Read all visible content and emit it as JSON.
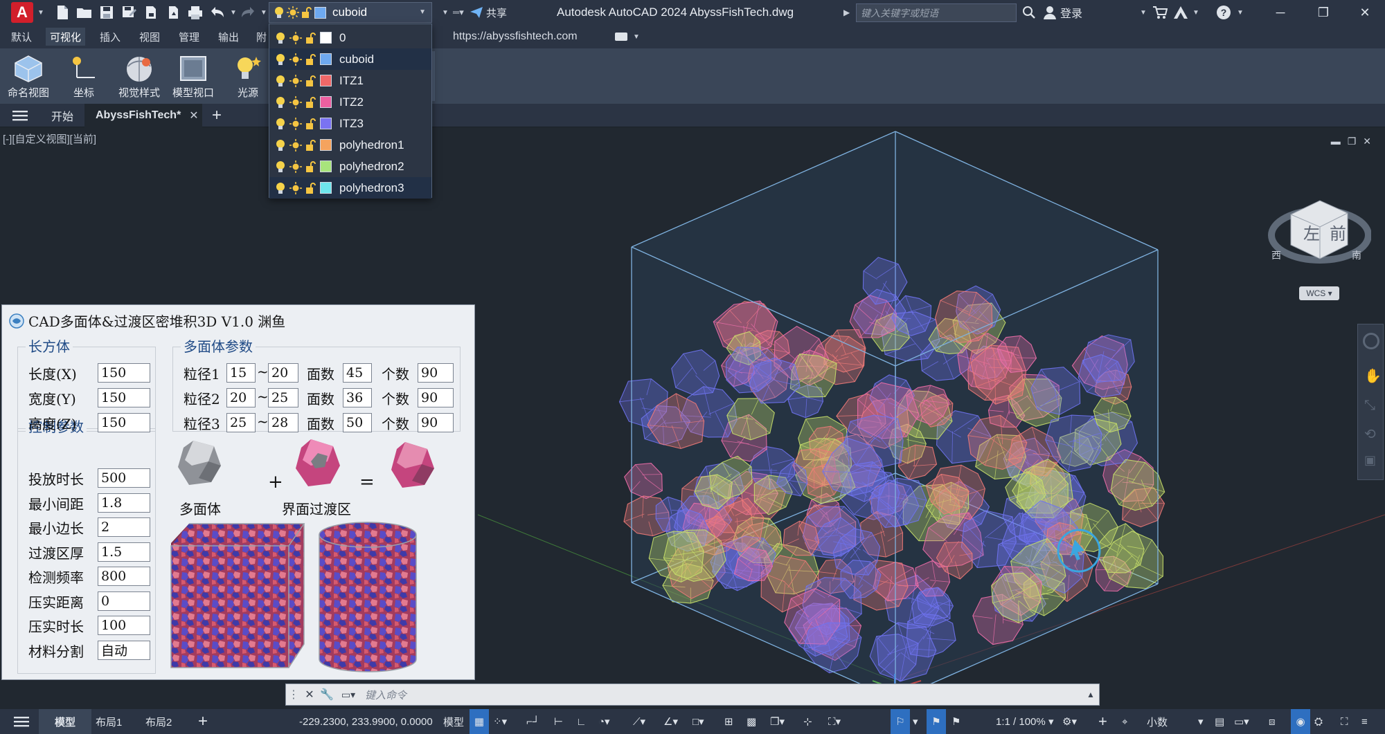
{
  "titlebar": {
    "logo": "A",
    "layer_current": "cuboid",
    "share": "共享",
    "app_title": "Autodesk AutoCAD 2024    AbyssFishTech.dwg",
    "search_placeholder": "键入关键字或短语",
    "login": "登录"
  },
  "ribbon": {
    "tabs": [
      "默认",
      "可视化",
      "插入",
      "视图",
      "管理",
      "输出",
      "附"
    ],
    "active_tab": "可视化",
    "url": "https://abyssfishtech.com",
    "buttons": [
      "命名视图",
      "坐标",
      "视觉样式",
      "模型视口",
      "光源"
    ]
  },
  "doc_tabs": {
    "start": "开始",
    "drawing": "AbyssFishTech*"
  },
  "viewport": {
    "label": "[-][自定义视图][当前]",
    "wcs": "WCS",
    "cube_left": "左",
    "cube_front": "前",
    "compass_w": "西",
    "compass_s": "南"
  },
  "layers": [
    {
      "name": "0",
      "color": "#ffffff"
    },
    {
      "name": "cuboid",
      "color": "#6ea9f0"
    },
    {
      "name": "ITZ1",
      "color": "#f06868"
    },
    {
      "name": "ITZ2",
      "color": "#ec5fa0"
    },
    {
      "name": "ITZ3",
      "color": "#7a73f2"
    },
    {
      "name": "polyhedron1",
      "color": "#f5a35e"
    },
    {
      "name": "polyhedron2",
      "color": "#a8e47c"
    },
    {
      "name": "polyhedron3",
      "color": "#6ee6ec"
    }
  ],
  "dialog": {
    "title": "CAD多面体&过渡区密堆积3D V1.0 渊鱼",
    "cuboid": {
      "title": "长方体",
      "fields": [
        {
          "label": "长度(X)",
          "value": "150"
        },
        {
          "label": "宽度(Y)",
          "value": "150"
        },
        {
          "label": "高度(Z)",
          "value": "150"
        }
      ]
    },
    "poly": {
      "title": "多面体参数",
      "rows": [
        {
          "label": "粒径1",
          "min": "15",
          "max": "20",
          "faces_label": "面数",
          "faces": "45",
          "count_label": "个数",
          "count": "90"
        },
        {
          "label": "粒径2",
          "min": "20",
          "max": "25",
          "faces_label": "面数",
          "faces": "36",
          "count_label": "个数",
          "count": "90"
        },
        {
          "label": "粒径3",
          "min": "25",
          "max": "28",
          "faces_label": "面数",
          "faces": "50",
          "count_label": "个数",
          "count": "90"
        }
      ],
      "tilde": "~"
    },
    "control": {
      "title": "控制参数",
      "fields": [
        {
          "label": "投放时长",
          "value": "500"
        },
        {
          "label": "最小间距",
          "value": "1.8"
        },
        {
          "label": "最小边长",
          "value": "2"
        },
        {
          "label": "过渡区厚",
          "value": "1.5"
        },
        {
          "label": "检测频率",
          "value": "800"
        },
        {
          "label": "压实距离",
          "value": "0"
        },
        {
          "label": "压实时长",
          "value": "100"
        },
        {
          "label": "材料分割",
          "value": "自动"
        }
      ]
    },
    "illustration": {
      "plus": "+",
      "equals": "=",
      "caption1": "多面体",
      "caption2": "界面过渡区"
    }
  },
  "cmdline": {
    "placeholder": "键入命令"
  },
  "statusbar": {
    "model_tab": "模型",
    "layout1": "布局1",
    "layout2": "布局2",
    "coords": "-229.2300, 233.9900, 0.0000",
    "space": "模型",
    "scale": "1:1 / 100%",
    "units": "小数"
  },
  "colors": {
    "blue_poly": "#6f73f0",
    "red_poly": "#f07a78",
    "pink_itz": "#ee6eaa",
    "green_poly": "#c8e06a",
    "cube_edge": "#7fb2e0"
  }
}
